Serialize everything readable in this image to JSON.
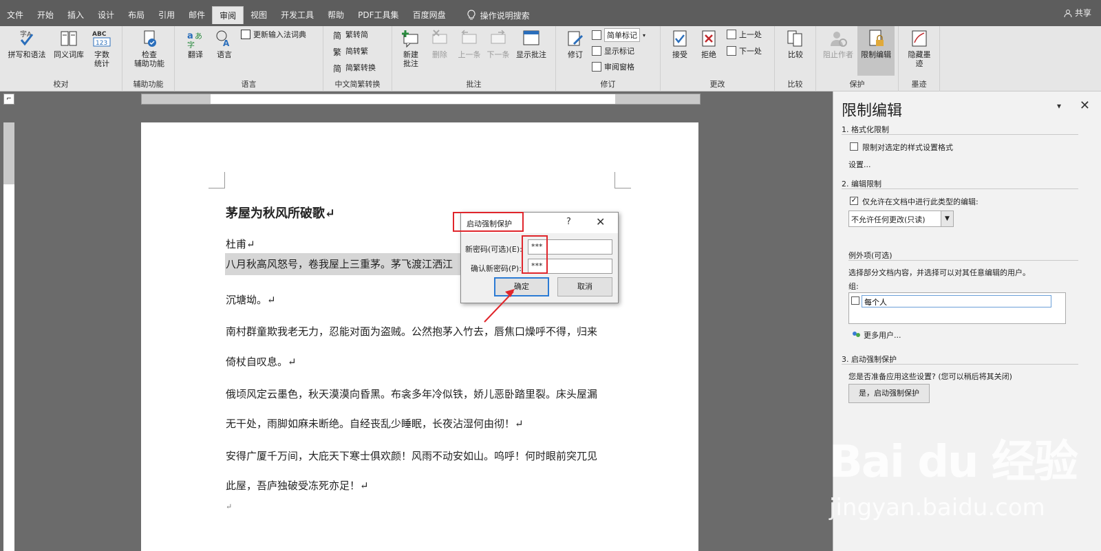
{
  "tabs": [
    "文件",
    "开始",
    "插入",
    "设计",
    "布局",
    "引用",
    "邮件",
    "审阅",
    "视图",
    "开发工具",
    "帮助",
    "PDF工具集",
    "百度网盘"
  ],
  "active_tab": "审阅",
  "tell_me": "操作说明搜索",
  "share": "共享",
  "ribbon": {
    "proofing": {
      "spell": "拼写和语法",
      "thesaurus": "同义词库",
      "wordcount": "字数\n统计",
      "label": "校对"
    },
    "access": {
      "check": "检查\n辅助功能",
      "label": "辅助功能"
    },
    "language": {
      "translate": "翻译",
      "language": "语言",
      "update_ime": "更新输入法词典",
      "label": "语言"
    },
    "chinese": {
      "to_simplified": "繁转简",
      "to_traditional": "简转繁",
      "convert": "简繁转换",
      "label": "中文简繁转换"
    },
    "comments": {
      "new": "新建\n批注",
      "delete": "删除",
      "prev": "上一条",
      "next": "下一条",
      "show": "显示批注",
      "label": "批注"
    },
    "tracking": {
      "track": "修订",
      "markup_mode": "简单标记",
      "show_markup": "显示标记",
      "review_pane": "审阅窗格",
      "label": "修订"
    },
    "changes": {
      "accept": "接受",
      "reject": "拒绝",
      "previous": "上一处",
      "next": "下一处",
      "label": "更改"
    },
    "compare": {
      "compare": "比较",
      "label": "比较"
    },
    "protect": {
      "block": "阻止作者",
      "restrict": "限制编辑",
      "label": "保护"
    },
    "ink": {
      "hide": "隐藏墨\n迹",
      "label": "墨迹"
    }
  },
  "document": {
    "title": "茅屋为秋风所破歌↵",
    "author": "杜甫↵",
    "lines": [
      "八月秋高风怒号，卷我屋上三重茅。茅飞渡江洒江",
      "沉塘坳。↵",
      "南村群童欺我老无力，忍能对面为盗贼。公然抱茅入竹去，唇焦口燥呼不得，归来",
      "倚杖自叹息。↵",
      "俄顷风定云墨色，秋天漠漠向昏黑。布衾多年冷似铁，娇儿恶卧踏里裂。床头屋漏",
      "无干处，雨脚如麻未断绝。自经丧乱少睡眠，长夜沾湿何由彻！↵",
      "安得广厦千万间，大庇天下寒士俱欢颜！风雨不动安如山。呜呼！何时眼前突兀见",
      "此屋，吾庐独破受冻死亦足！↵",
      "↵"
    ]
  },
  "dialog": {
    "title": "启动强制保护",
    "help": "?",
    "close": "✕",
    "new_password_label": "新密码(可选)(E):",
    "new_password_value": "***",
    "confirm_label": "确认新密码(P):",
    "confirm_value": "***",
    "ok": "确定",
    "cancel": "取消"
  },
  "pane": {
    "title": "限制编辑",
    "menu": "▾",
    "close": "✕",
    "s1": "1. 格式化限制",
    "s1_check": "限制对选定的样式设置格式",
    "s1_settings": "设置...",
    "s2": "2. 编辑限制",
    "s2_check": "仅允许在文档中进行此类型的编辑:",
    "s2_combo": "不允许任何更改(只读)",
    "exceptions": "例外项(可选)",
    "exceptions_desc": "选择部分文档内容，并选择可以对其任意编辑的用户。",
    "groups": "组:",
    "everyone": "每个人",
    "more_users": "更多用户...",
    "s3": "3. 启动强制保护",
    "s3_desc": "您是否准备应用这些设置? (您可以稍后将其关闭)",
    "s3_button": "是，启动强制保护"
  },
  "watermark": {
    "brand": "Bai du 经验",
    "url": "jingyan.baidu.com"
  }
}
